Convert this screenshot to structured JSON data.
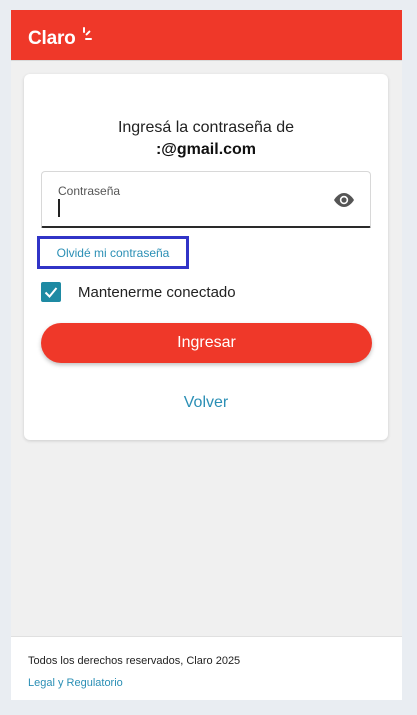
{
  "header": {
    "logo_text": "Claro",
    "brand_color": "#ef3829"
  },
  "login": {
    "title": "Ingresá la contraseña de",
    "email_visible": ":@gmail.com",
    "password": {
      "label": "Contraseña",
      "value": "",
      "show_icon": "eye-icon"
    },
    "forgot_link": "Olvidé mi contraseña",
    "remember": {
      "label": "Mantenerme conectado",
      "checked": true
    },
    "submit_label": "Ingresar",
    "back_label": "Volver"
  },
  "footer": {
    "copyright": "Todos los derechos reservados, Claro 2025",
    "legal_link": "Legal y Regulatorio"
  },
  "colors": {
    "accent_red": "#ef3829",
    "link_blue": "#2b8fb5",
    "checkbox_teal": "#1e8aa3",
    "highlight_box": "#3134c7"
  }
}
